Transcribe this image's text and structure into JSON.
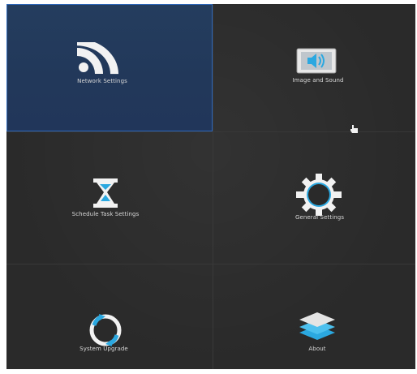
{
  "tiles": [
    {
      "id": "network",
      "label": "Network Settings",
      "icon": "wifi-icon",
      "selected": true
    },
    {
      "id": "image-sound",
      "label": "Image and Sound",
      "icon": "speaker-icon",
      "selected": false
    },
    {
      "id": "schedule",
      "label": "Schedule Task Settings",
      "icon": "hourglass-icon",
      "selected": false
    },
    {
      "id": "general",
      "label": "General Settings",
      "icon": "gear-icon",
      "selected": false
    },
    {
      "id": "upgrade",
      "label": "System Upgrade",
      "icon": "refresh-icon",
      "selected": false
    },
    {
      "id": "about",
      "label": "About",
      "icon": "layers-icon",
      "selected": false
    }
  ],
  "colors": {
    "accent": "#2c66b8",
    "selected_bg": "#233b5c",
    "icon_blue": "#2ba8e0",
    "icon_white": "#f2f2f2",
    "background": "#2a2a2a"
  }
}
